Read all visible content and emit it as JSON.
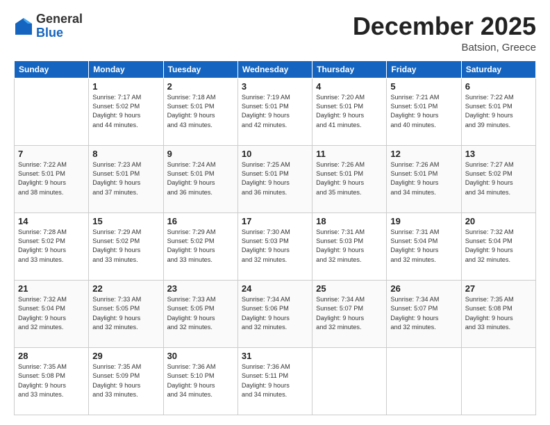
{
  "header": {
    "logo_general": "General",
    "logo_blue": "Blue",
    "month_title": "December 2025",
    "location": "Batsion, Greece"
  },
  "days_of_week": [
    "Sunday",
    "Monday",
    "Tuesday",
    "Wednesday",
    "Thursday",
    "Friday",
    "Saturday"
  ],
  "weeks": [
    [
      {
        "day": "",
        "info": ""
      },
      {
        "day": "1",
        "info": "Sunrise: 7:17 AM\nSunset: 5:02 PM\nDaylight: 9 hours\nand 44 minutes."
      },
      {
        "day": "2",
        "info": "Sunrise: 7:18 AM\nSunset: 5:01 PM\nDaylight: 9 hours\nand 43 minutes."
      },
      {
        "day": "3",
        "info": "Sunrise: 7:19 AM\nSunset: 5:01 PM\nDaylight: 9 hours\nand 42 minutes."
      },
      {
        "day": "4",
        "info": "Sunrise: 7:20 AM\nSunset: 5:01 PM\nDaylight: 9 hours\nand 41 minutes."
      },
      {
        "day": "5",
        "info": "Sunrise: 7:21 AM\nSunset: 5:01 PM\nDaylight: 9 hours\nand 40 minutes."
      },
      {
        "day": "6",
        "info": "Sunrise: 7:22 AM\nSunset: 5:01 PM\nDaylight: 9 hours\nand 39 minutes."
      }
    ],
    [
      {
        "day": "7",
        "info": "Sunrise: 7:22 AM\nSunset: 5:01 PM\nDaylight: 9 hours\nand 38 minutes."
      },
      {
        "day": "8",
        "info": "Sunrise: 7:23 AM\nSunset: 5:01 PM\nDaylight: 9 hours\nand 37 minutes."
      },
      {
        "day": "9",
        "info": "Sunrise: 7:24 AM\nSunset: 5:01 PM\nDaylight: 9 hours\nand 36 minutes."
      },
      {
        "day": "10",
        "info": "Sunrise: 7:25 AM\nSunset: 5:01 PM\nDaylight: 9 hours\nand 36 minutes."
      },
      {
        "day": "11",
        "info": "Sunrise: 7:26 AM\nSunset: 5:01 PM\nDaylight: 9 hours\nand 35 minutes."
      },
      {
        "day": "12",
        "info": "Sunrise: 7:26 AM\nSunset: 5:01 PM\nDaylight: 9 hours\nand 34 minutes."
      },
      {
        "day": "13",
        "info": "Sunrise: 7:27 AM\nSunset: 5:02 PM\nDaylight: 9 hours\nand 34 minutes."
      }
    ],
    [
      {
        "day": "14",
        "info": "Sunrise: 7:28 AM\nSunset: 5:02 PM\nDaylight: 9 hours\nand 33 minutes."
      },
      {
        "day": "15",
        "info": "Sunrise: 7:29 AM\nSunset: 5:02 PM\nDaylight: 9 hours\nand 33 minutes."
      },
      {
        "day": "16",
        "info": "Sunrise: 7:29 AM\nSunset: 5:02 PM\nDaylight: 9 hours\nand 33 minutes."
      },
      {
        "day": "17",
        "info": "Sunrise: 7:30 AM\nSunset: 5:03 PM\nDaylight: 9 hours\nand 32 minutes."
      },
      {
        "day": "18",
        "info": "Sunrise: 7:31 AM\nSunset: 5:03 PM\nDaylight: 9 hours\nand 32 minutes."
      },
      {
        "day": "19",
        "info": "Sunrise: 7:31 AM\nSunset: 5:04 PM\nDaylight: 9 hours\nand 32 minutes."
      },
      {
        "day": "20",
        "info": "Sunrise: 7:32 AM\nSunset: 5:04 PM\nDaylight: 9 hours\nand 32 minutes."
      }
    ],
    [
      {
        "day": "21",
        "info": "Sunrise: 7:32 AM\nSunset: 5:04 PM\nDaylight: 9 hours\nand 32 minutes."
      },
      {
        "day": "22",
        "info": "Sunrise: 7:33 AM\nSunset: 5:05 PM\nDaylight: 9 hours\nand 32 minutes."
      },
      {
        "day": "23",
        "info": "Sunrise: 7:33 AM\nSunset: 5:05 PM\nDaylight: 9 hours\nand 32 minutes."
      },
      {
        "day": "24",
        "info": "Sunrise: 7:34 AM\nSunset: 5:06 PM\nDaylight: 9 hours\nand 32 minutes."
      },
      {
        "day": "25",
        "info": "Sunrise: 7:34 AM\nSunset: 5:07 PM\nDaylight: 9 hours\nand 32 minutes."
      },
      {
        "day": "26",
        "info": "Sunrise: 7:34 AM\nSunset: 5:07 PM\nDaylight: 9 hours\nand 32 minutes."
      },
      {
        "day": "27",
        "info": "Sunrise: 7:35 AM\nSunset: 5:08 PM\nDaylight: 9 hours\nand 33 minutes."
      }
    ],
    [
      {
        "day": "28",
        "info": "Sunrise: 7:35 AM\nSunset: 5:08 PM\nDaylight: 9 hours\nand 33 minutes."
      },
      {
        "day": "29",
        "info": "Sunrise: 7:35 AM\nSunset: 5:09 PM\nDaylight: 9 hours\nand 33 minutes."
      },
      {
        "day": "30",
        "info": "Sunrise: 7:36 AM\nSunset: 5:10 PM\nDaylight: 9 hours\nand 34 minutes."
      },
      {
        "day": "31",
        "info": "Sunrise: 7:36 AM\nSunset: 5:11 PM\nDaylight: 9 hours\nand 34 minutes."
      },
      {
        "day": "",
        "info": ""
      },
      {
        "day": "",
        "info": ""
      },
      {
        "day": "",
        "info": ""
      }
    ]
  ]
}
